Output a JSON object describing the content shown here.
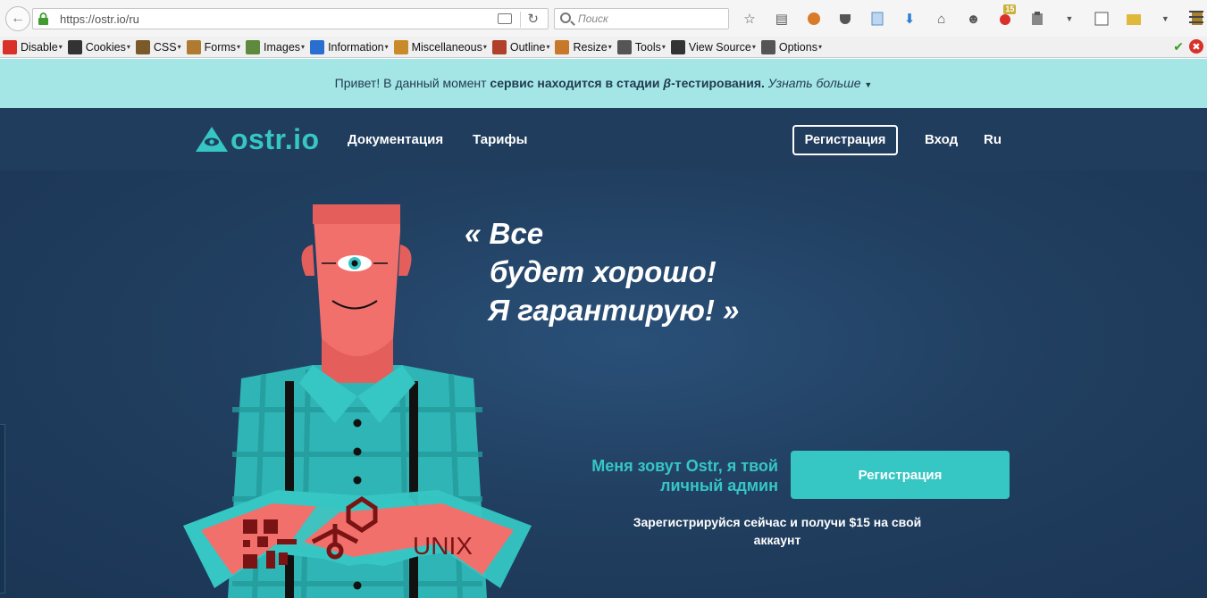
{
  "browser": {
    "url": "https://ostr.io/ru",
    "search_placeholder": "Поиск",
    "badge_count": "15"
  },
  "webdev_toolbar": {
    "items": [
      {
        "label": "Disable",
        "icon": "disable-icon",
        "color": "#d9302a"
      },
      {
        "label": "Cookies",
        "icon": "cookies-icon",
        "color": "#333333"
      },
      {
        "label": "CSS",
        "icon": "css-icon",
        "color": "#7a5a2a"
      },
      {
        "label": "Forms",
        "icon": "forms-icon",
        "color": "#b07a30"
      },
      {
        "label": "Images",
        "icon": "images-icon",
        "color": "#5d8a3c"
      },
      {
        "label": "Information",
        "icon": "information-icon",
        "color": "#2a6fcf"
      },
      {
        "label": "Miscellaneous",
        "icon": "miscellaneous-icon",
        "color": "#c98a2a"
      },
      {
        "label": "Outline",
        "icon": "outline-icon",
        "color": "#b0402a"
      },
      {
        "label": "Resize",
        "icon": "resize-icon",
        "color": "#c8782a"
      },
      {
        "label": "Tools",
        "icon": "tools-icon",
        "color": "#555555"
      },
      {
        "label": "View Source",
        "icon": "view-source-icon",
        "color": "#333333"
      },
      {
        "label": "Options",
        "icon": "options-icon",
        "color": "#555555"
      }
    ]
  },
  "beta_notice": {
    "prefix": "Привет! В данный момент ",
    "strong": "сервис находится в стадии ",
    "beta": "β",
    "suffix": "-тестирования.",
    "more": "Узнать больше"
  },
  "header": {
    "logo": "ostr.io",
    "nav": [
      "Документация",
      "Тарифы"
    ],
    "register": "Регистрация",
    "login": "Вход",
    "lang": "Ru"
  },
  "hero": {
    "quote": [
      "« Все",
      "будет хорошо!",
      "Я гарантирую! »"
    ],
    "tagline": "Меня зовут Ostr, я твой личный админ",
    "cta": "Регистрация",
    "promo": "Зарегистрируйся сейчас и получи $15 на свой аккаунт",
    "tattoo_text": "UNIX"
  },
  "colors": {
    "accent": "#36c6c4",
    "header_bg": "#213d5d",
    "beta_bg": "#a4e5e5",
    "skin": "#f2706c"
  }
}
